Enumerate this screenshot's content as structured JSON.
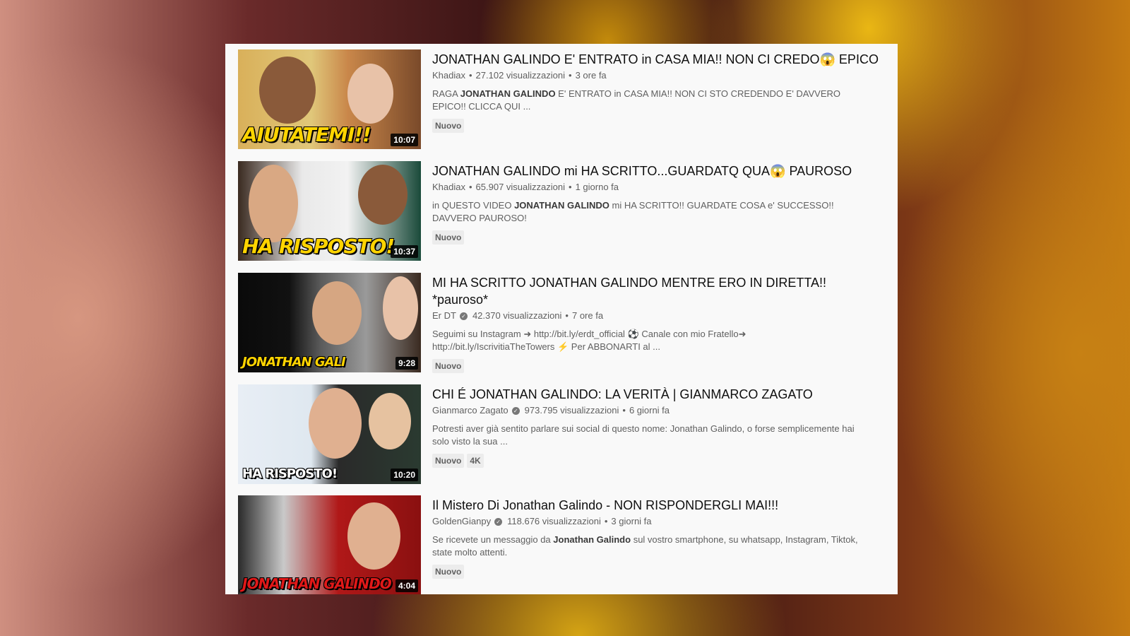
{
  "results": [
    {
      "title": "JONATHAN GALINDO E' ENTRATO in CASA MIA!! NON CI CREDO😱 EPICO",
      "channel": "Khadiax",
      "verified": false,
      "views": "27.102 visualizzazioni",
      "age": "3 ore fa",
      "desc_pre": "RAGA ",
      "desc_bold": "JONATHAN GALINDO",
      "desc_post": " E' ENTRATO in CASA MIA!! NON CI STO CREDENDO E' DAVVERO EPICO!! CLICCA QUI ...",
      "badges": [
        "Nuovo"
      ],
      "duration": "10:07",
      "thumb_text": "AIUTATEMI!!"
    },
    {
      "title": "JONATHAN GALINDO mi HA SCRITTO...GUARDATQ QUA😱 PAUROSO",
      "channel": "Khadiax",
      "verified": false,
      "views": "65.907 visualizzazioni",
      "age": "1 giorno fa",
      "desc_pre": "in QUESTO VIDEO ",
      "desc_bold": "JONATHAN GALINDO",
      "desc_post": " mi HA SCRITTO!! GUARDATE COSA e' SUCCESSO!! DAVVERO PAUROSO!",
      "badges": [
        "Nuovo"
      ],
      "duration": "10:37",
      "thumb_text": "HA RISPOSTO!"
    },
    {
      "title": "MI HA SCRITTO JONATHAN GALINDO MENTRE ERO IN DIRETTA!! *pauroso*",
      "channel": "Er DT",
      "verified": true,
      "views": "42.370 visualizzazioni",
      "age": "7 ore fa",
      "desc_pre": "Seguimi su Instagram ➜ http://bit.ly/erdt_official ⚽ Canale con mio Fratello➜ http://bit.ly/IscrivitiaTheTowers ⚡ Per ABBONARTI al ...",
      "desc_bold": "",
      "desc_post": "",
      "badges": [
        "Nuovo"
      ],
      "duration": "9:28",
      "thumb_text": "JONATHAN GALI"
    },
    {
      "title": "CHI É JONATHAN GALINDO: LA VERITÀ | GIANMARCO ZAGATO",
      "channel": "Gianmarco Zagato",
      "verified": true,
      "views": "973.795 visualizzazioni",
      "age": "6 giorni fa",
      "desc_pre": "Potresti aver già sentito parlare sui social di questo nome: Jonathan Galindo, o forse semplicemente hai solo visto la sua ...",
      "desc_bold": "",
      "desc_post": "",
      "badges": [
        "Nuovo",
        "4K"
      ],
      "duration": "10:20",
      "thumb_text": "HA RISPOSTO!"
    },
    {
      "title": "Il Mistero Di Jonathan Galindo - NON RISPONDERGLI MAI!!!",
      "channel": "GoldenGianpy",
      "verified": true,
      "views": "118.676 visualizzazioni",
      "age": "3 giorni fa",
      "desc_pre": "Se ricevete un messaggio da ",
      "desc_bold": "Jonathan Galindo",
      "desc_post": " sul vostro smartphone, su whatsapp, Instagram, Tiktok, state molto attenti.",
      "badges": [
        "Nuovo"
      ],
      "duration": "4:04",
      "thumb_text": "JONATHAN GALINDO"
    }
  ],
  "separator": "•"
}
